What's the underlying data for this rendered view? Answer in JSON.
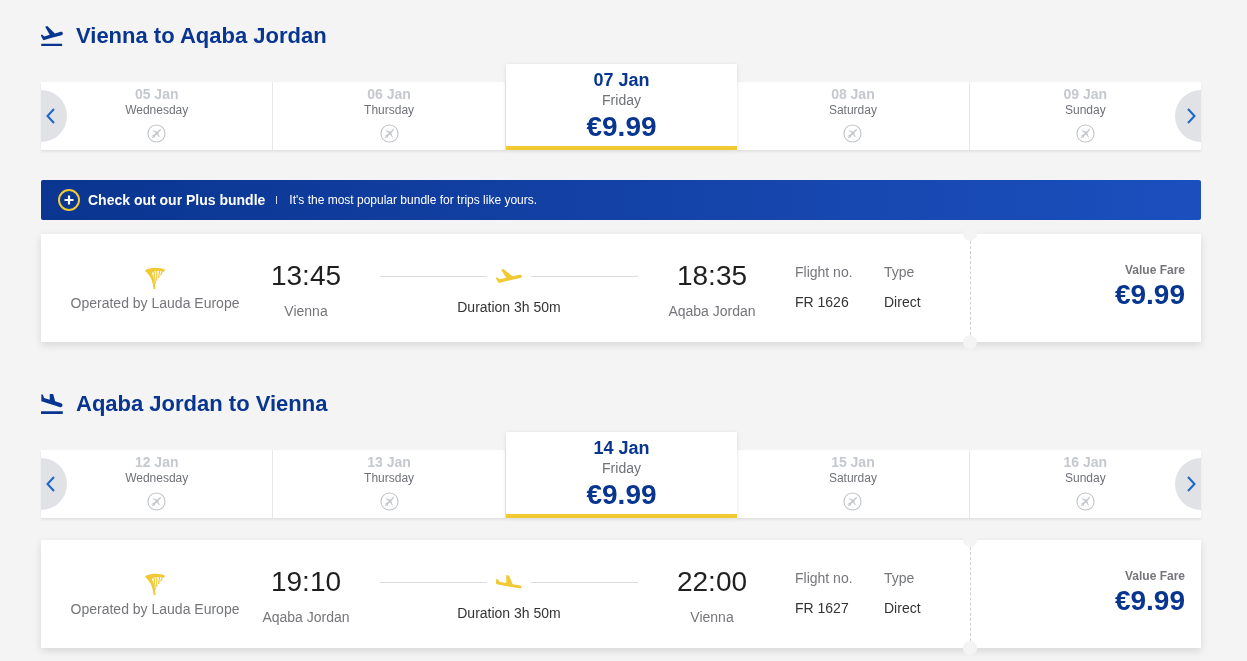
{
  "sections": [
    {
      "kind": "outbound",
      "title": "Vienna to Aqaba Jordan",
      "dates": [
        {
          "date": "05 Jan",
          "day": "Wednesday",
          "selected": false
        },
        {
          "date": "06 Jan",
          "day": "Thursday",
          "selected": false
        },
        {
          "date": "07 Jan",
          "day": "Friday",
          "price": "€9.99",
          "selected": true
        },
        {
          "date": "08 Jan",
          "day": "Saturday",
          "selected": false
        },
        {
          "date": "09 Jan",
          "day": "Sunday",
          "selected": false
        }
      ],
      "banner": {
        "title": "Check out our Plus bundle",
        "text": "It's the most popular bundle for trips like yours."
      },
      "flight": {
        "operator": "Operated by Lauda Europe",
        "departure_time": "13:45",
        "departure_city": "Vienna",
        "duration": "Duration 3h 50m",
        "arrival_time": "18:35",
        "arrival_city": "Aqaba Jordan",
        "flight_no_label": "Flight no.",
        "flight_no": "FR 1626",
        "type_label": "Type",
        "type": "Direct",
        "fare_name": "Value Fare",
        "fare_price": "€9.99"
      }
    },
    {
      "kind": "return",
      "title": "Aqaba Jordan to Vienna",
      "dates": [
        {
          "date": "12 Jan",
          "day": "Wednesday",
          "selected": false
        },
        {
          "date": "13 Jan",
          "day": "Thursday",
          "selected": false
        },
        {
          "date": "14 Jan",
          "day": "Friday",
          "price": "€9.99",
          "selected": true
        },
        {
          "date": "15 Jan",
          "day": "Saturday",
          "selected": false
        },
        {
          "date": "16 Jan",
          "day": "Sunday",
          "selected": false
        }
      ],
      "flight": {
        "operator": "Operated by Lauda Europe",
        "departure_time": "19:10",
        "departure_city": "Aqaba Jordan",
        "duration": "Duration 3h 50m",
        "arrival_time": "22:00",
        "arrival_city": "Vienna",
        "flight_no_label": "Flight no.",
        "flight_no": "FR 1627",
        "type_label": "Type",
        "type": "Direct",
        "fare_name": "Value Fare",
        "fare_price": "€9.99"
      }
    }
  ]
}
